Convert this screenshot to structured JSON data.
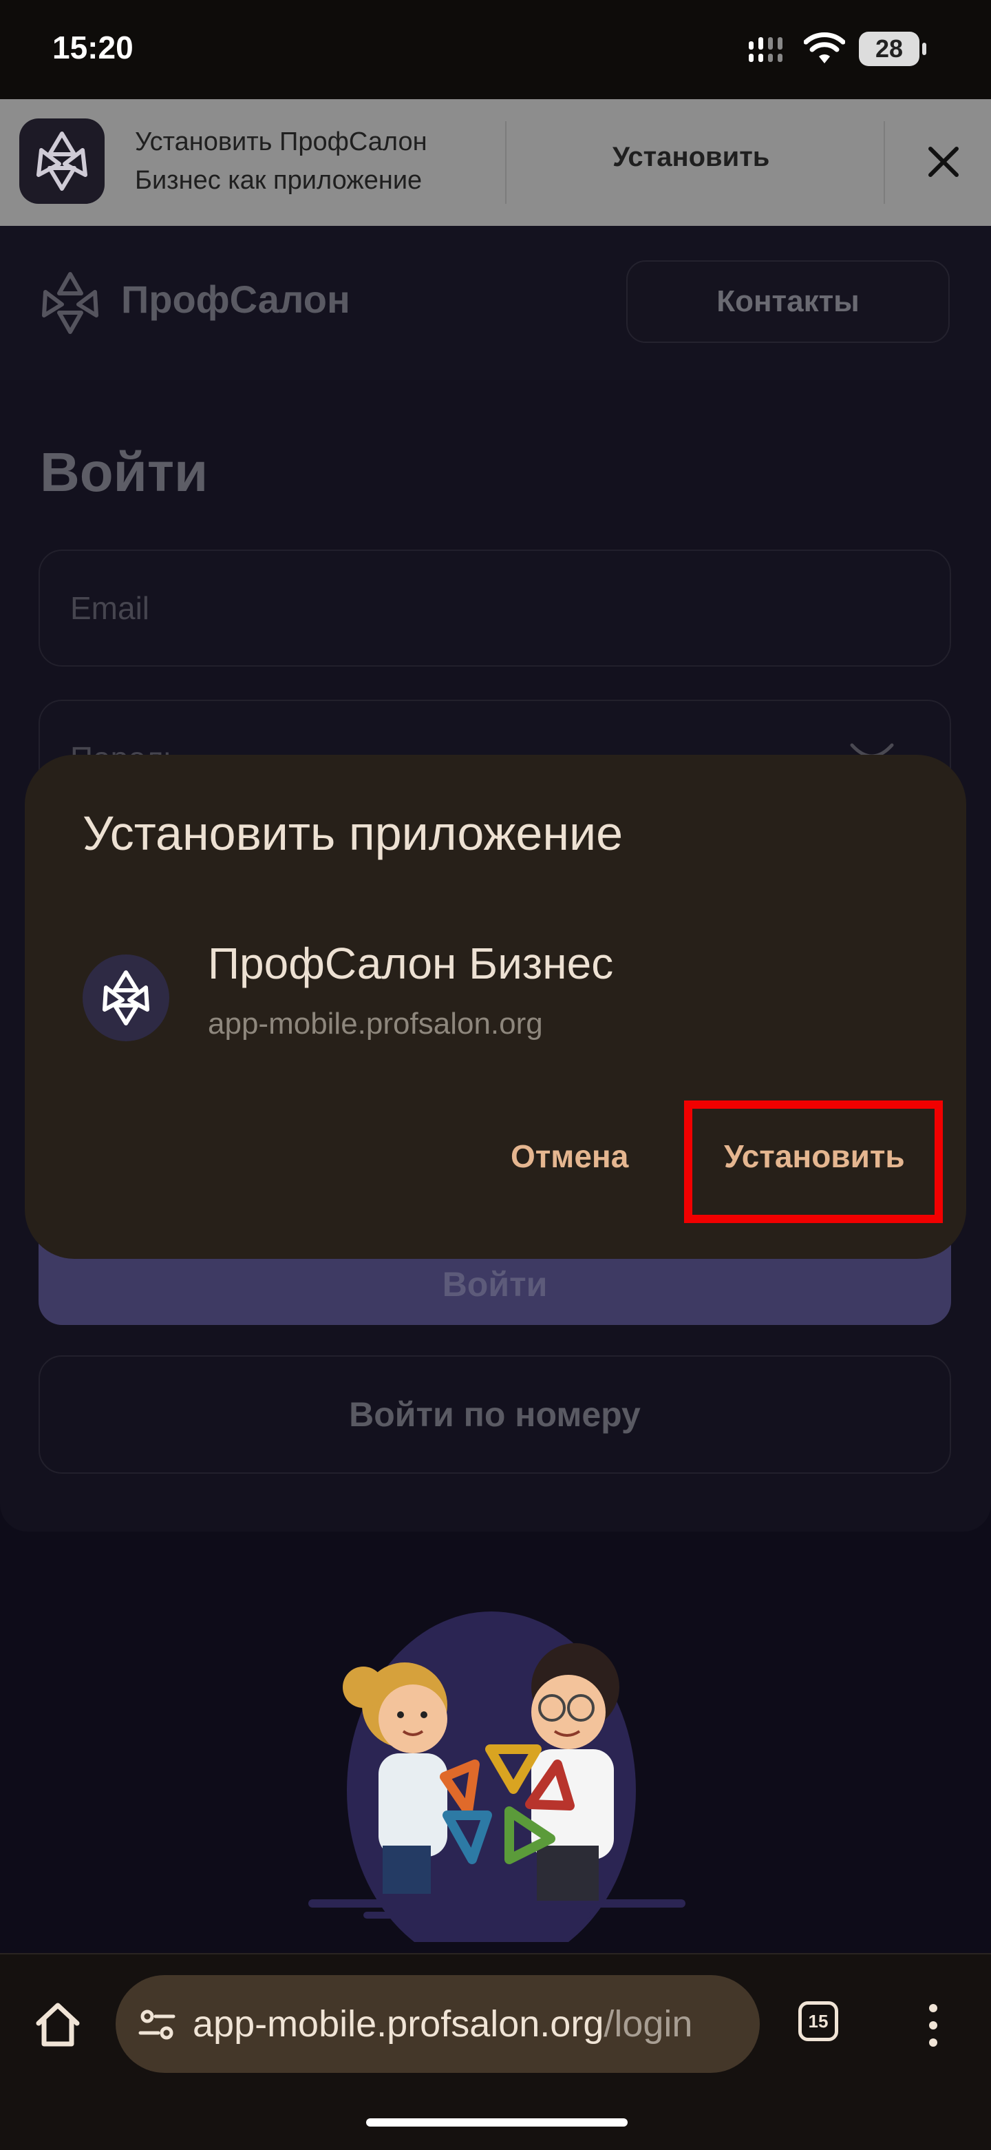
{
  "status_bar": {
    "time": "15:20",
    "battery": "28"
  },
  "install_banner": {
    "text_line1": "Установить ПрофСалон",
    "text_line2": "Бизнес как приложение",
    "install_label": "Установить",
    "icons": [
      "app-logo-icon",
      "close-icon"
    ]
  },
  "header": {
    "logo_text": "ПрофСалон",
    "contacts_label": "Контакты"
  },
  "form": {
    "title": "Войти",
    "email_placeholder": "Email",
    "password_placeholder": "Пароль",
    "login_label": "Войти",
    "phone_login_label": "Войти по номеру"
  },
  "dialog": {
    "title": "Установить приложение",
    "app_name": "ПрофСалон Бизнес",
    "app_url": "app-mobile.profsalon.org",
    "cancel_label": "Отмена",
    "install_label": "Установить",
    "highlight_color": "#f10000"
  },
  "browser": {
    "url_host": "app-mobile.profsalon.org",
    "url_path": "/login",
    "tab_count": "15",
    "icons": [
      "home-icon",
      "site-settings-icon",
      "tabs-icon",
      "more-menu-icon"
    ]
  },
  "colors": {
    "accent": "#e5b690",
    "dialog_bg": "#272019",
    "page_bg": "#0e0c19"
  }
}
